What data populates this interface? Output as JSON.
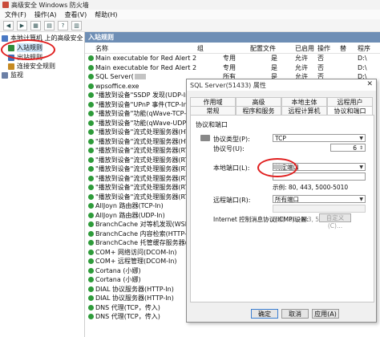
{
  "window": {
    "title": "高级安全 Windows 防火墙"
  },
  "menu": [
    "文件(F)",
    "操作(A)",
    "查看(V)",
    "帮助(H)"
  ],
  "tree": {
    "root": "本地计算机 上的高级安全 Wind",
    "items": [
      "入站规则",
      "出站规则",
      "连接安全规则",
      "监视"
    ]
  },
  "pane": {
    "header": "入站规则",
    "columns": [
      "名称",
      "组",
      "配置文件",
      "已启用",
      "操作",
      "替",
      "程序"
    ]
  },
  "rules": [
    {
      "name": "Main executable for Red Alert 2",
      "profile": "专用",
      "enabled": "是",
      "action": "允许",
      "override": "否",
      "program": "D:\\"
    },
    {
      "name": "Main executable for Red Alert 2",
      "profile": "专用",
      "enabled": "是",
      "action": "允许",
      "override": "否",
      "program": "D:\\"
    },
    {
      "name": "SQL Server(",
      "profile": "所有",
      "enabled": "是",
      "action": "允许",
      "override": "否",
      "program": "D:\\"
    },
    {
      "name": "wpsoffice.exe",
      "profile": "",
      "enabled": "",
      "action": "",
      "override": "",
      "program": "D:\\"
    },
    {
      "name": "\"播放到设备\"SSDP 发现(UDP-In)",
      "profile": "",
      "enabled": "",
      "action": "",
      "override": "",
      "program": "%"
    },
    {
      "name": "\"播放到设备\"UPnP 事件(TCP-In)",
      "profile": "",
      "enabled": "",
      "action": "",
      "override": "",
      "program": ""
    },
    {
      "name": "\"播放到设备\"功能(qWave-TCP-In)",
      "profile": "",
      "enabled": "",
      "action": "",
      "override": "",
      "program": ""
    },
    {
      "name": "\"播放到设备\"功能(qWave-UDP-In)",
      "profile": "",
      "enabled": "",
      "action": "",
      "override": "",
      "program": "%"
    },
    {
      "name": "\"播放到设备\"流式处理服务器(HTTP-Str",
      "profile": "",
      "enabled": "",
      "action": "",
      "override": "",
      "program": ""
    },
    {
      "name": "\"播放到设备\"流式处理服务器(HTTP-Str",
      "profile": "",
      "enabled": "",
      "action": "",
      "override": "",
      "program": ""
    },
    {
      "name": "\"播放到设备\"流式处理服务器(RTCP-Stre",
      "profile": "",
      "enabled": "",
      "action": "",
      "override": "",
      "program": ""
    },
    {
      "name": "\"播放到设备\"流式处理服务器(RTCP-Stre",
      "profile": "",
      "enabled": "",
      "action": "",
      "override": "",
      "program": ""
    },
    {
      "name": "\"播放到设备\"流式处理服务器(RTCP-Stre",
      "profile": "",
      "enabled": "",
      "action": "",
      "override": "",
      "program": ""
    },
    {
      "name": "\"播放到设备\"流式处理服务器(RTSP-Stre",
      "profile": "",
      "enabled": "",
      "action": "",
      "override": "",
      "program": ""
    },
    {
      "name": "\"播放到设备\"流式处理服务器(RTSP-Stre",
      "profile": "",
      "enabled": "",
      "action": "",
      "override": "",
      "program": ""
    },
    {
      "name": "\"播放到设备\"流式处理服务器(RTSP-Stre",
      "profile": "",
      "enabled": "",
      "action": "",
      "override": "",
      "program": ""
    },
    {
      "name": "AllJoyn 路由器(TCP-In)",
      "profile": "",
      "enabled": "",
      "action": "",
      "override": "",
      "program": "%"
    },
    {
      "name": "AllJoyn 路由器(UDP-In)",
      "profile": "",
      "enabled": "",
      "action": "",
      "override": "",
      "program": "%"
    },
    {
      "name": "BranchCache 对等机发现(WSD-In)",
      "profile": "",
      "enabled": "",
      "action": "",
      "override": "",
      "program": "S"
    },
    {
      "name": "BranchCache 内容检索(HTTP-In)",
      "profile": "",
      "enabled": "",
      "action": "",
      "override": "",
      "program": "S"
    },
    {
      "name": "BranchCache 托管缓存服务器(HTTP-In)",
      "profile": "",
      "enabled": "",
      "action": "",
      "override": "",
      "program": "S"
    },
    {
      "name": "COM+ 网络访问(DCOM-In)",
      "profile": "",
      "enabled": "",
      "action": "",
      "override": "",
      "program": "%"
    },
    {
      "name": "COM+ 远程管理(DCOM-In)",
      "profile": "",
      "enabled": "",
      "action": "",
      "override": "",
      "program": "%"
    },
    {
      "name": "Cortana (小娜)",
      "profile": "",
      "enabled": "",
      "action": "",
      "override": "",
      "program": "%"
    },
    {
      "name": "Cortana (小娜)",
      "profile": "",
      "enabled": "",
      "action": "",
      "override": "",
      "program": "%"
    },
    {
      "name": "DIAL 协议服务器(HTTP-In)",
      "profile": "",
      "enabled": "",
      "action": "",
      "override": "",
      "program": ""
    },
    {
      "name": "DIAL 协议服务器(HTTP-In)",
      "profile": "",
      "enabled": "",
      "action": "",
      "override": "",
      "program": ""
    },
    {
      "name": "DNS 代理(TCP，传入)",
      "profile": "",
      "enabled": "",
      "action": "",
      "override": "",
      "program": ""
    },
    {
      "name": "DNS 代理(TCP，传入)",
      "profile": "",
      "enabled": "",
      "action": "",
      "override": "",
      "program": ""
    }
  ],
  "dialog": {
    "title": "SQL Server(51433) 属性",
    "close": "✕",
    "tabs_row1": [
      "作用域",
      "高级",
      "本地主体",
      "远程用户"
    ],
    "tabs_row2": [
      "常规",
      "程序和服务",
      "远程计算机",
      "协议和端口"
    ],
    "section": "协议和端口",
    "protocol_type_label": "协议类型(P):",
    "protocol_type_value": "TCP",
    "protocol_num_label": "协议号(U):",
    "protocol_num_value": "6",
    "local_port_label": "本地端口(L):",
    "local_port_value": "特定端口",
    "local_example": "示例: 80, 443, 5000-5010",
    "remote_port_label": "远程端口(R):",
    "remote_port_value": "所有端口",
    "remote_example": "示例: 80, 443, 5000-5010",
    "icmp_label": "Internet 控制消息协议(ICMP)设置:",
    "custom_button": "自定义(C)...",
    "buttons": [
      "确定",
      "取消",
      "应用(A)"
    ]
  }
}
